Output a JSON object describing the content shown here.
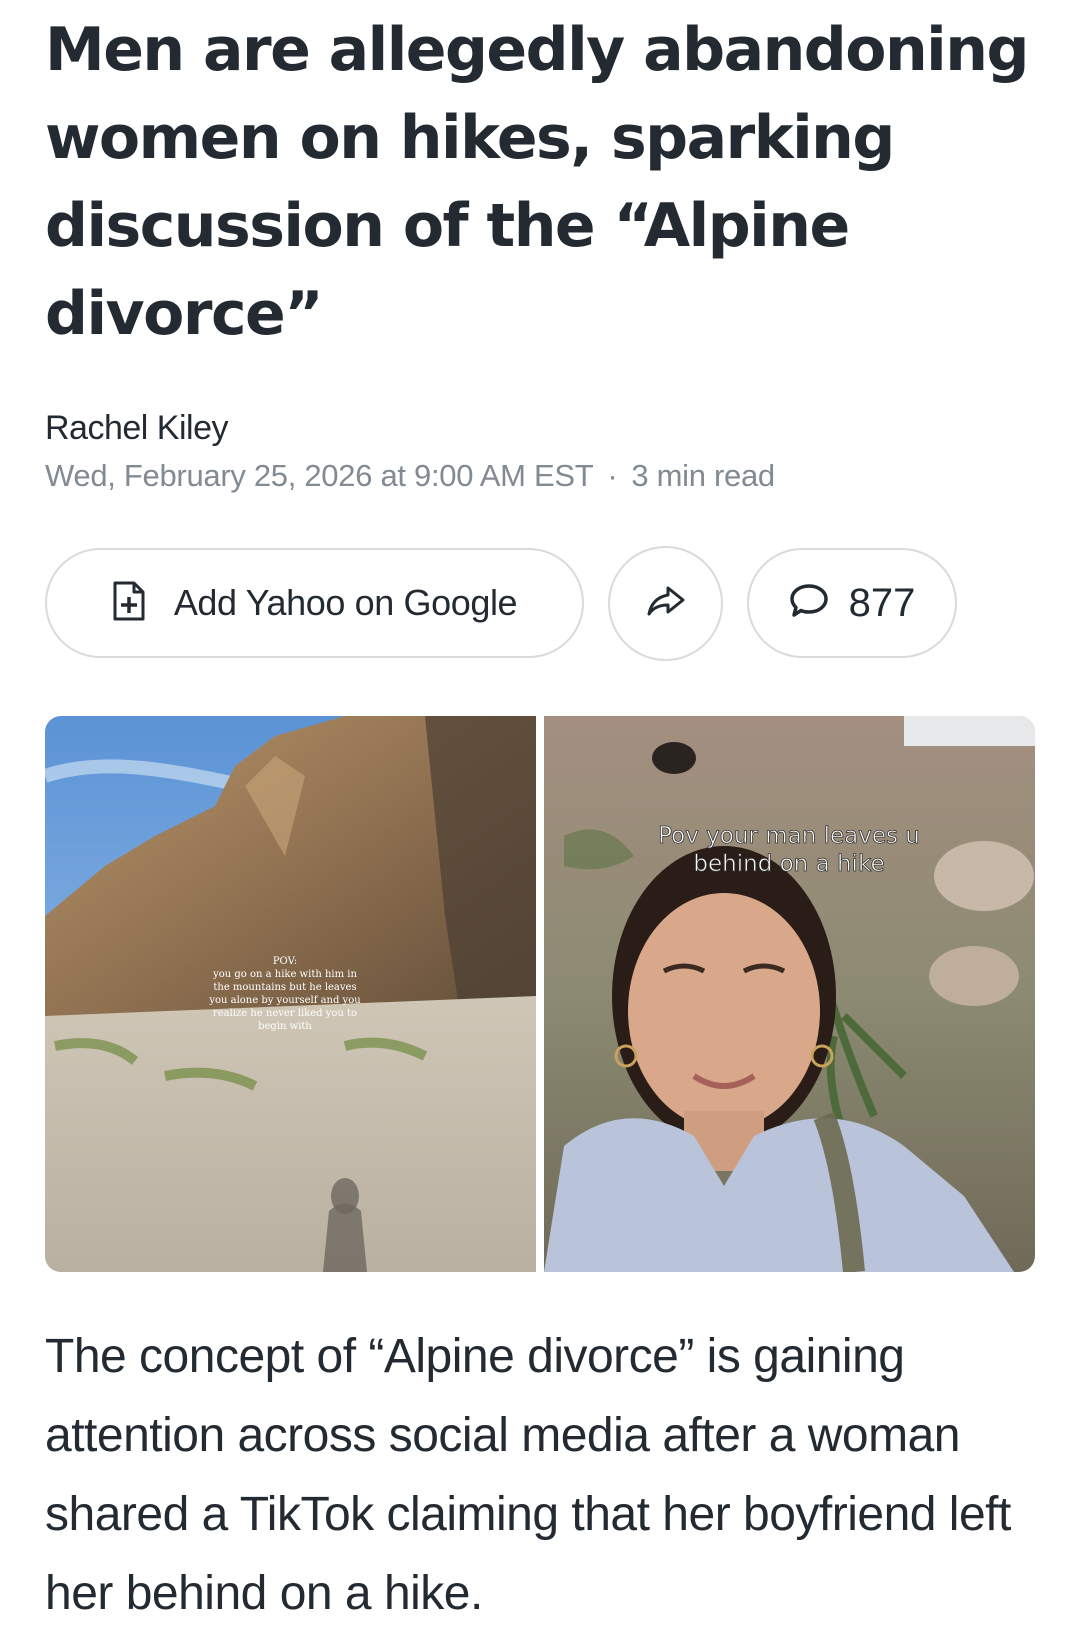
{
  "article": {
    "headline": "Men are allegedly abandoning women on hikes, sparking discussion of the “Alpine divorce”",
    "author": "Rachel Kiley",
    "date": "Wed, February 25, 2026 at 9:00 AM EST",
    "separator": "·",
    "read_time": "3 min read",
    "body": "The concept of “Alpine divorce” is gaining attention across social media after a woman shared a TikTok claiming that her boyfriend left her behind on a hike."
  },
  "actions": {
    "add_yahoo_label": "Add Yahoo on Google",
    "add_yahoo_icon": "add-document-icon",
    "share_icon": "share-arrow-icon",
    "comments_icon": "speech-bubble-icon",
    "comment_count": "877"
  },
  "images": {
    "left_caption_lines": [
      "POV:",
      "you go on a hike with him in",
      "the mountains but he leaves",
      "you alone by yourself and you",
      "realize he never liked you to",
      "begin with"
    ],
    "right_caption_lines": [
      "Pov your man leaves u",
      "behind on a hike"
    ]
  },
  "colors": {
    "text": "#232a31",
    "meta": "#828a93",
    "border": "#d8dade"
  }
}
